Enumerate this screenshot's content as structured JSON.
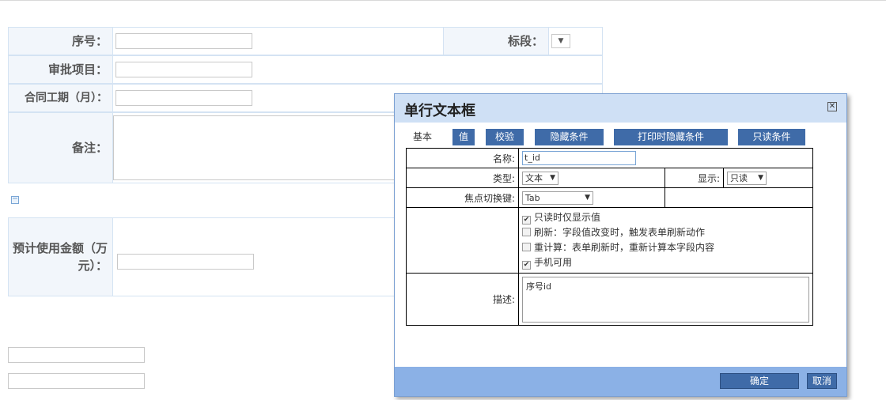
{
  "form": {
    "seq_label": "序号：",
    "section_label": "标段：",
    "section_select": "▼",
    "approval_label": "审批项目：",
    "period_label": "合同工期（月）：",
    "remark_label": "备注：",
    "amount_label_line1": "预计使用金额（万",
    "amount_label_line2": "元）："
  },
  "dialog": {
    "title": "单行文本框",
    "close_glyph": "✕",
    "tabs": [
      {
        "label": "基本",
        "active": true
      },
      {
        "label": "值"
      },
      {
        "label": "校验"
      },
      {
        "label": "隐藏条件"
      },
      {
        "label": "打印时隐藏条件"
      },
      {
        "label": "只读条件"
      }
    ],
    "fields": {
      "name_label": "名称:",
      "name_value": "t_id",
      "type_label": "类型:",
      "type_value": "文本",
      "display_label": "显示:",
      "display_value": "只读",
      "focus_key_label": "焦点切换键:",
      "focus_key_value": "Tab",
      "options": [
        {
          "label": "只读时仅显示值",
          "checked": true
        },
        {
          "label": "刷新：字段值改变时，触发表单刷新动作",
          "checked": false
        },
        {
          "label": "重计算：表单刷新时，重新计算本字段内容",
          "checked": false
        },
        {
          "label": "手机可用",
          "checked": true
        }
      ],
      "desc_label": "描述:",
      "desc_value": "序号id"
    },
    "ok_label": "确定",
    "cancel_label": "取消"
  },
  "colors": {
    "tab_bg": "#3f6ba8",
    "footer_bg": "#8bb1e6",
    "title_bg": "#cfe0f5"
  },
  "icons": {
    "dropdown": "chevron-down-icon",
    "close": "close-icon",
    "checkbox": "check-icon"
  }
}
